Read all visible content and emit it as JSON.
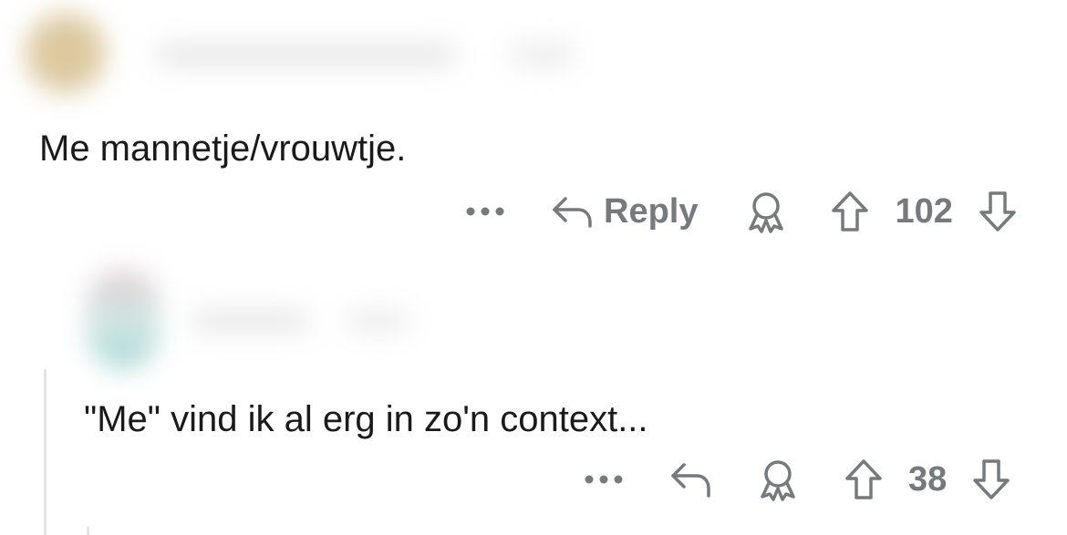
{
  "comments": [
    {
      "text": "Me mannetje/vrouwtje.",
      "reply_label": "Reply",
      "vote_count": "102",
      "avatar_color": "#dcc9a0",
      "icons": [
        "more-icon",
        "reply-arrow-icon",
        "award-icon",
        "upvote-icon",
        "downvote-icon"
      ]
    },
    {
      "text": "\"Me\" vind ik al erg in zo'n context...",
      "vote_count": "38",
      "avatar_color": "#a9d6d4",
      "icons": [
        "more-icon",
        "reply-arrow-icon",
        "award-icon",
        "upvote-icon",
        "downvote-icon"
      ]
    }
  ],
  "colors": {
    "text": "#1a1a1b",
    "meta": "#777a7d",
    "thread_line": "#e4e4e4"
  }
}
